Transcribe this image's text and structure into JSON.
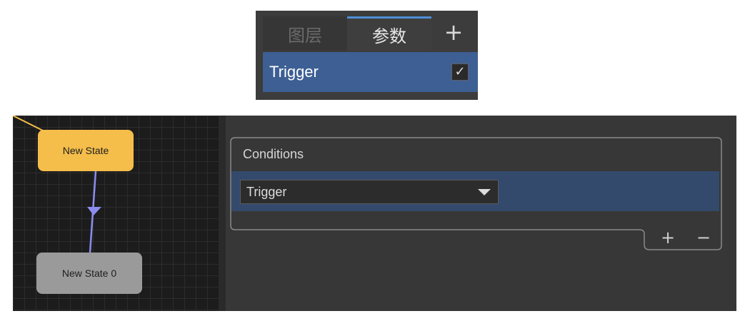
{
  "params_panel": {
    "tabs": [
      "图层",
      "参数"
    ],
    "active_tab": "参数",
    "add_label": "+",
    "parameters": [
      {
        "name": "Trigger",
        "checked": true,
        "check_glyph": "✓"
      }
    ]
  },
  "graph": {
    "states": [
      {
        "label": "New State",
        "color": "#f5bd4a"
      },
      {
        "label": "New State 0",
        "color": "#9a9a9a"
      }
    ],
    "transition_color": "#8c8cf0",
    "entry_link_color": "#f5bd4a"
  },
  "inspector": {
    "conditions": {
      "title": "Conditions",
      "items": [
        {
          "parameter": "Trigger"
        }
      ],
      "add_label": "+",
      "remove_label": "−"
    }
  },
  "colors": {
    "selection": "#3d5f94",
    "tab_accent": "#4d8fd6"
  }
}
